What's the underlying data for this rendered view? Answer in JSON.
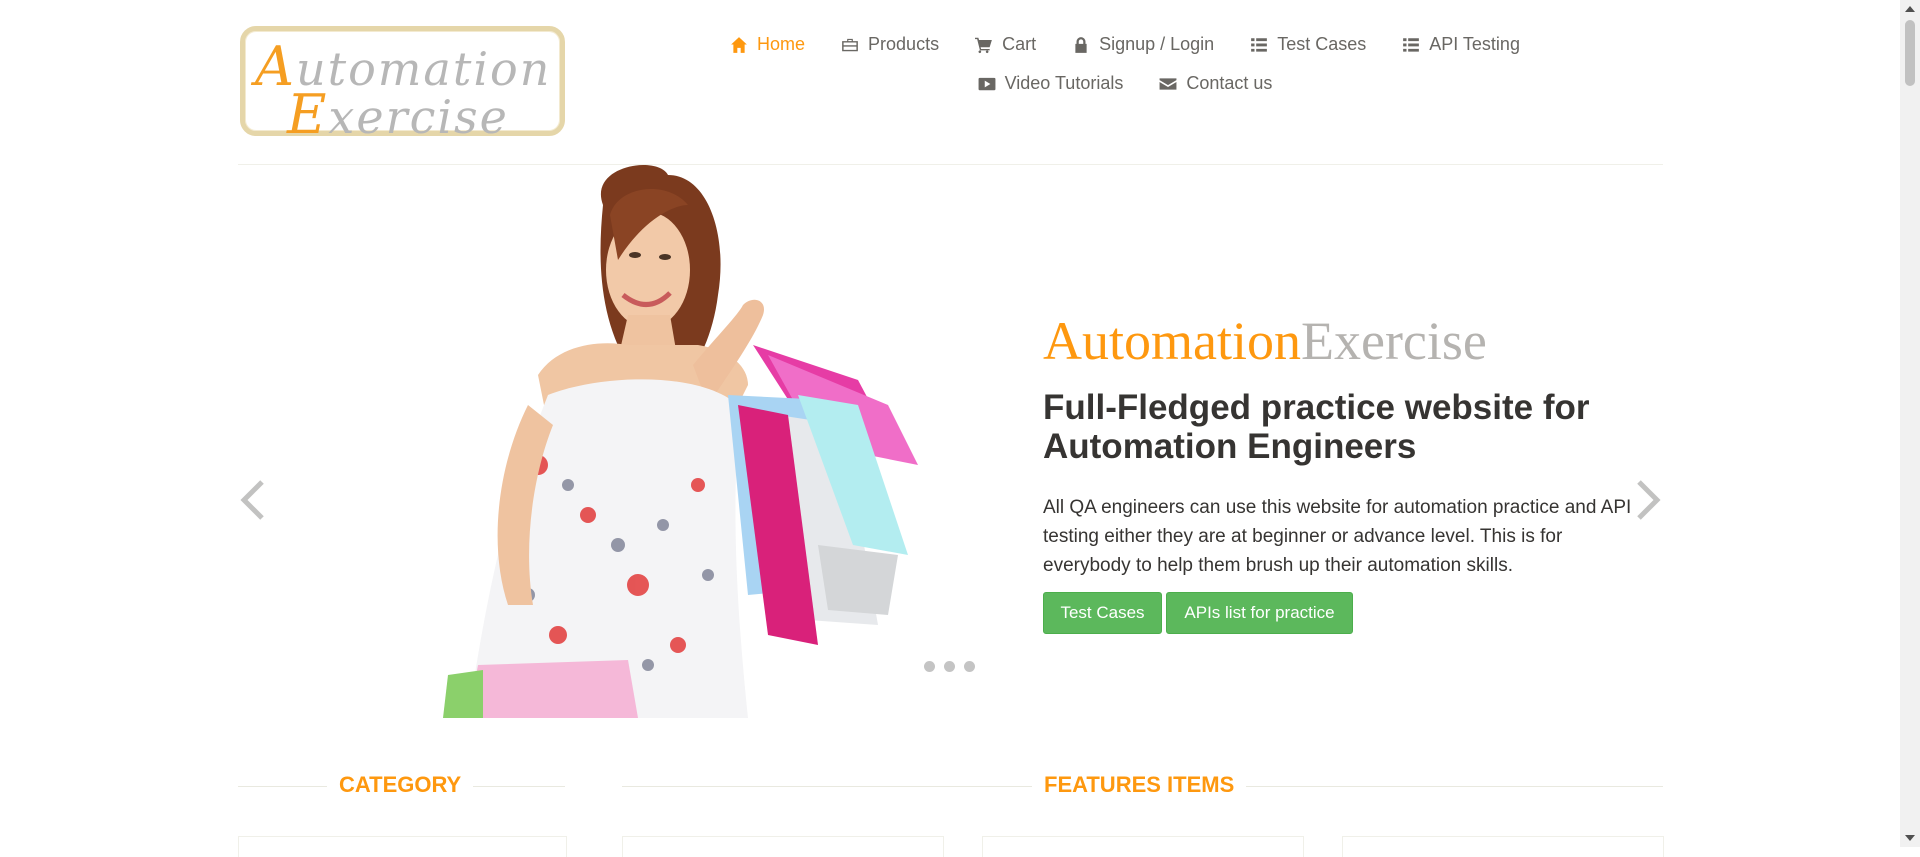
{
  "logo": {
    "line1_cap": "A",
    "line1_rest": "utomation",
    "line2_cap": "E",
    "line2_rest": "xercise"
  },
  "nav": {
    "items": [
      {
        "label": "Home",
        "icon": "home-icon",
        "active": true
      },
      {
        "label": "Products",
        "icon": "briefcase-icon"
      },
      {
        "label": "Cart",
        "icon": "cart-icon"
      },
      {
        "label": "Signup / Login",
        "icon": "lock-icon"
      },
      {
        "label": "Test Cases",
        "icon": "list-icon"
      },
      {
        "label": "API Testing",
        "icon": "list-icon"
      },
      {
        "label": "Video Tutorials",
        "icon": "youtube-icon"
      },
      {
        "label": "Contact us",
        "icon": "envelope-icon"
      }
    ]
  },
  "hero": {
    "brand_a": "Automation",
    "brand_b": "Exercise",
    "subtitle": "Full-Fledged practice website for Automation Engineers",
    "description": "All QA engineers can use this website for automation practice and API testing either they are at beginner or advance level. This is for everybody to help them brush up their automation skills.",
    "btn_test_cases": "Test Cases",
    "btn_apis": "APIs list for practice",
    "slide_count": 3
  },
  "sections": {
    "category": "CATEGORY",
    "features": "FEATURES ITEMS"
  },
  "colors": {
    "accent": "#fe980f",
    "button": "#5cb85c",
    "text": "#696763",
    "dark": "#363432"
  }
}
